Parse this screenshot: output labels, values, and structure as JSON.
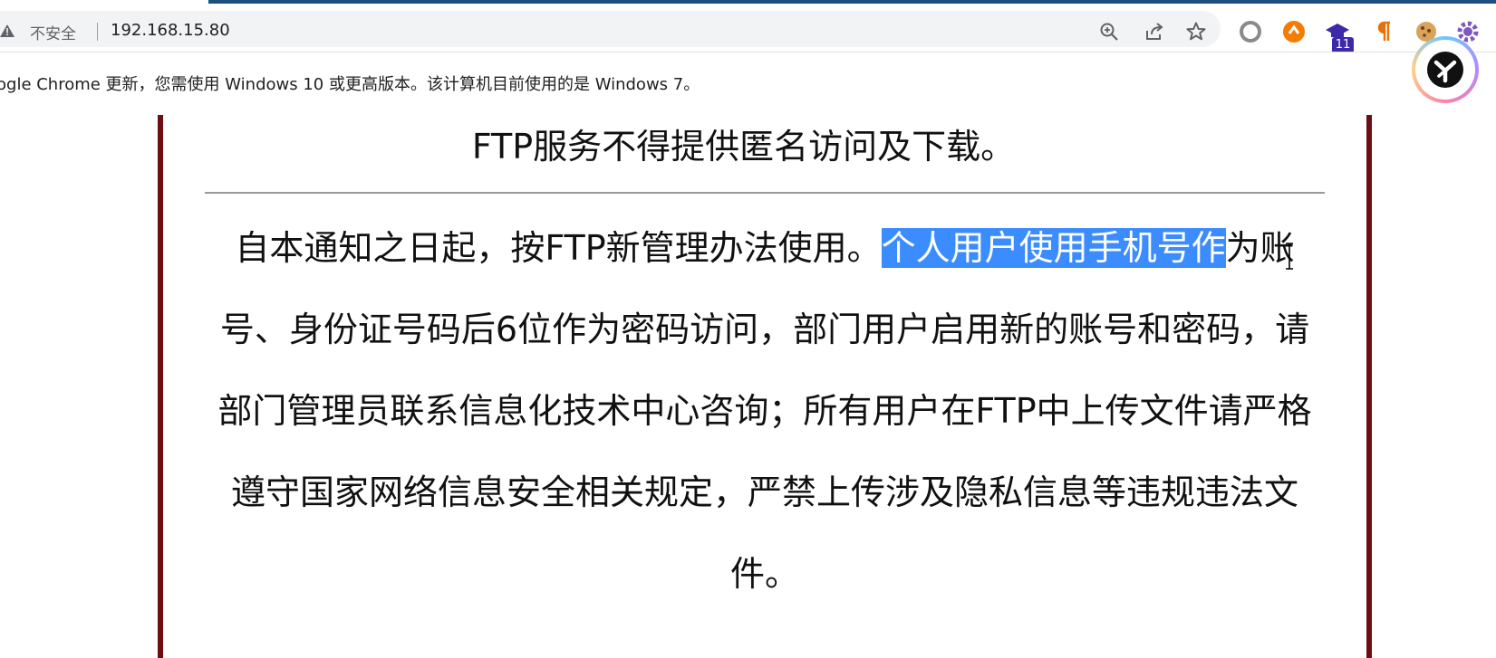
{
  "browser": {
    "security_label": "不安全",
    "url": "192.168.15.80",
    "extension_badge": "11"
  },
  "infobar": {
    "message": "ogle Chrome 更新，您需使用 Windows 10 或更高版本。该计算机目前使用的是 Windows 7。"
  },
  "page": {
    "heading_line": "FTP服务不得提供匿名访问及下载。",
    "paragraph_before": "自本通知之日起，按FTP新管理办法使用。",
    "paragraph_highlight": "个人用户使用手机号作",
    "paragraph_after": "为账号、身份证号码后6位作为密码访问，部门用户启用新的账号和密码，请部门管理员联系信息化技术中心咨询；所有用户在FTP中上传文件请严格遵守国家网络信息安全相关规定，严禁上传涉及隐私信息等违规违法文件。"
  },
  "colors": {
    "frame_border": "#6b0f12",
    "selection": "#3b8cff",
    "title_bar": "#1c4f80"
  },
  "icons": [
    "warning-icon",
    "zoom-icon",
    "share-icon",
    "star-icon",
    "circle-extension-icon",
    "orange-extension-icon",
    "graduation-cap-extension-icon",
    "pilcrow-extension-icon",
    "cookie-extension-icon",
    "gear-extension-icon",
    "assistant-fab-icon",
    "text-cursor-icon"
  ]
}
